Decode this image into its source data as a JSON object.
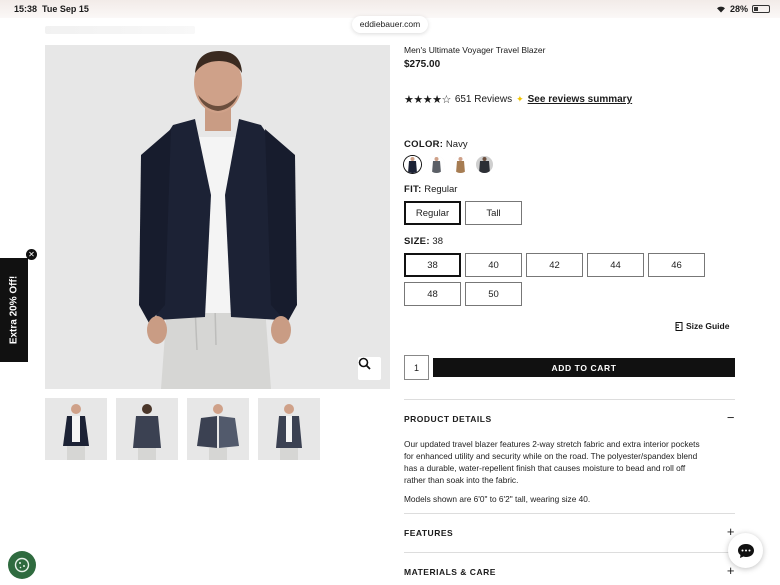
{
  "status": {
    "time": "15:38",
    "date": "Tue Sep 15",
    "battery": "28%"
  },
  "browser": {
    "url": "eddiebauer.com"
  },
  "promo": {
    "label": "Extra 20% Off!"
  },
  "product": {
    "title": "Men's Ultimate Voyager Travel Blazer",
    "price": "$275.00",
    "rating": 4,
    "reviews_count": "651 Reviews",
    "reviews_summary_link": "See reviews summary"
  },
  "color": {
    "label": "COLOR:",
    "value": "Navy"
  },
  "fit": {
    "label": "FIT:",
    "value": "Regular",
    "options": [
      "Regular",
      "Tall"
    ]
  },
  "size": {
    "label": "SIZE:",
    "value": "38",
    "options": [
      "38",
      "40",
      "42",
      "44",
      "46",
      "48",
      "50"
    ]
  },
  "size_guide": "Size Guide",
  "quantity": "1",
  "add_to_cart": "ADD TO CART",
  "sections": {
    "details_title": "PRODUCT DETAILS",
    "details_text": "Our updated travel blazer features 2-way stretch fabric and extra interior pockets for enhanced utility and security while on the road. The polyester/spandex blend has a durable, water-repellent finish that causes moisture to bead and roll off rather than soak into the fabric.",
    "details_models": "Models shown are 6'0\" to 6'2\" tall, wearing size 40.",
    "features_title": "FEATURES",
    "materials_title": "MATERIALS & CARE",
    "collapse_symbol": "−",
    "expand_symbol": "+"
  },
  "colors": {
    "navy": "#1c2235",
    "accent_gold": "#f0c400",
    "cookie_green": "#2f6b3f"
  }
}
